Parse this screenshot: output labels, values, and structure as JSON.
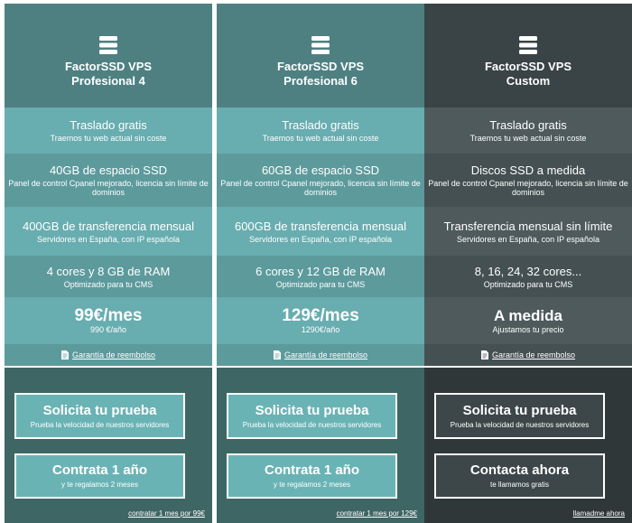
{
  "plans": [
    {
      "title_line1": "FactorSSD VPS",
      "title_line2": "Profesional 4",
      "features": [
        {
          "main": "Traslado gratis",
          "sub": "Traemos tu web actual sin coste"
        },
        {
          "main": "40GB de espacio SSD",
          "sub": "Panel de control Cpanel mejorado, licencia sin límite de dominios"
        },
        {
          "main": "400GB de transferencia mensual",
          "sub": "Servidores en España, con IP española"
        },
        {
          "main": "4 cores y 8 GB de RAM",
          "sub": "Optimizado para tu CMS"
        }
      ],
      "price_main": "99€/mes",
      "price_sub": "990 €/año",
      "guarantee": "Garantía de reembolso",
      "btn1_main": "Solicita tu prueba",
      "btn1_sub": "Prueba la velocidad de nuestros servidores",
      "btn2_main": "Contrata 1 año",
      "btn2_sub": "y te regalamos 2 meses",
      "footer_link": "contratar 1 mes por 99€"
    },
    {
      "title_line1": "FactorSSD VPS",
      "title_line2": "Profesional 6",
      "features": [
        {
          "main": "Traslado gratis",
          "sub": "Traemos tu web actual sin coste"
        },
        {
          "main": "60GB de espacio SSD",
          "sub": "Panel de control Cpanel mejorado, licencia sin límite de dominios"
        },
        {
          "main": "600GB de transferencia mensual",
          "sub": "Servidores en España, con IP española"
        },
        {
          "main": "6 cores y 12 GB de RAM",
          "sub": "Optimizado para tu CMS"
        }
      ],
      "price_main": "129€/mes",
      "price_sub": "1290€/año",
      "guarantee": "Garantía de reembolso",
      "btn1_main": "Solicita tu prueba",
      "btn1_sub": "Prueba la velocidad de nuestros servidores",
      "btn2_main": "Contrata 1 año",
      "btn2_sub": "y te regalamos 2 meses",
      "footer_link": "contratar 1 mes por 129€"
    },
    {
      "title_line1": "FactorSSD VPS",
      "title_line2": "Custom",
      "features": [
        {
          "main": "Traslado gratis",
          "sub": "Traemos tu web actual sin coste"
        },
        {
          "main": "Discos SSD a medida",
          "sub": "Panel de control Cpanel mejorado, licencia sin límite de dominios"
        },
        {
          "main": "Transferencia mensual sin límite",
          "sub": "Servidores en España, con IP española"
        },
        {
          "main": "8, 16, 24, 32 cores...",
          "sub": "Optimizado para tu CMS"
        }
      ],
      "price_main": "A medida",
      "price_sub": "Ajustamos tu precio",
      "guarantee": "Garantía de reembolso",
      "btn1_main": "Solicita tu prueba",
      "btn1_sub": "Prueba la velocidad de nuestros servidores",
      "btn2_main": "Contacta ahora",
      "btn2_sub": "te llamamos gratis",
      "footer_link": "llamadme ahora"
    }
  ],
  "icons": {
    "plan_icon": "server-icon",
    "guarantee_icon": "document-icon"
  },
  "colors": {
    "teal_head": "#4e8082",
    "teal_row_light": "#68adb0",
    "teal_row_mid": "#5d9a9c",
    "teal_bottom": "#3e6664",
    "teal_button": "#6ab3b5",
    "dark_head": "#3a4345",
    "dark_row_light": "#4e5a5c",
    "dark_row_mid": "#455052",
    "dark_bottom": "#2f3739",
    "dark_button": "#3d4749"
  }
}
